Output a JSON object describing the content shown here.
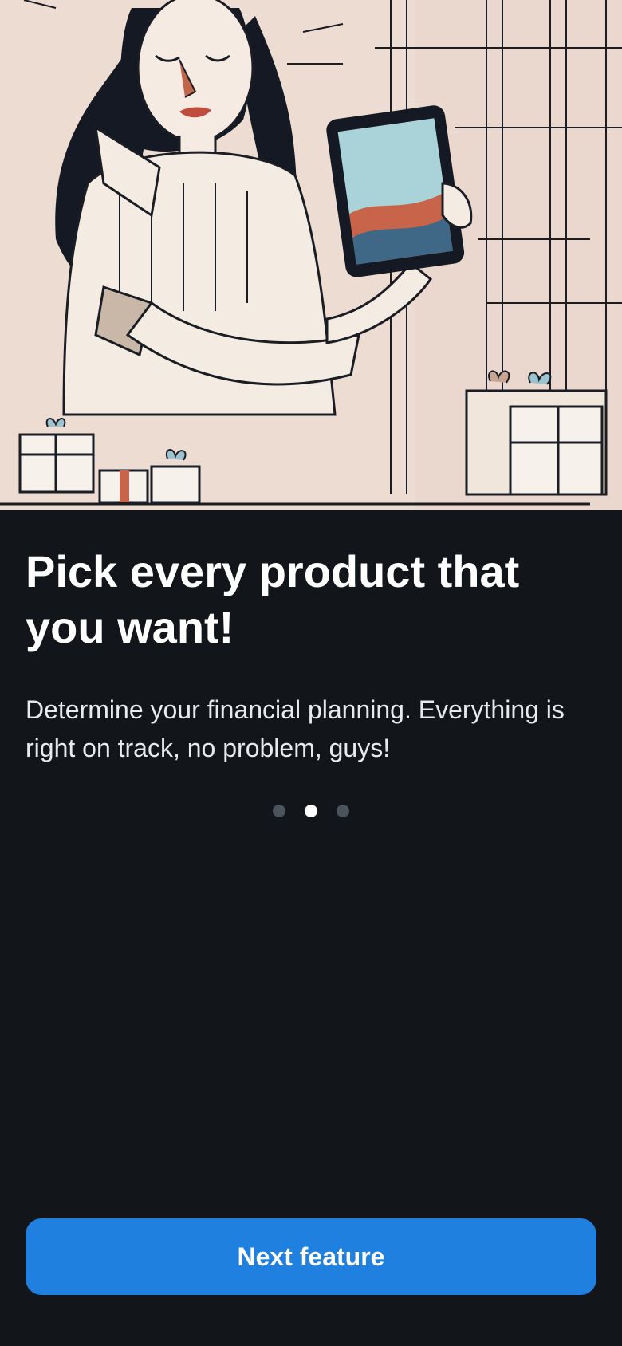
{
  "hero": {
    "illustration": "woman-holding-tablet-illustration"
  },
  "onboarding": {
    "title": "Pick every product that you want!",
    "description": "Determine your financial planning. Everything is right on track, no problem, guys!"
  },
  "pagination": {
    "total": 3,
    "active_index": 1
  },
  "actions": {
    "next_label": "Next feature"
  },
  "colors": {
    "background": "#121519",
    "accent": "#1f80e0",
    "dot_inactive": "#4b535d",
    "dot_active": "#ffffff",
    "hero_background": "#eddcd2"
  }
}
